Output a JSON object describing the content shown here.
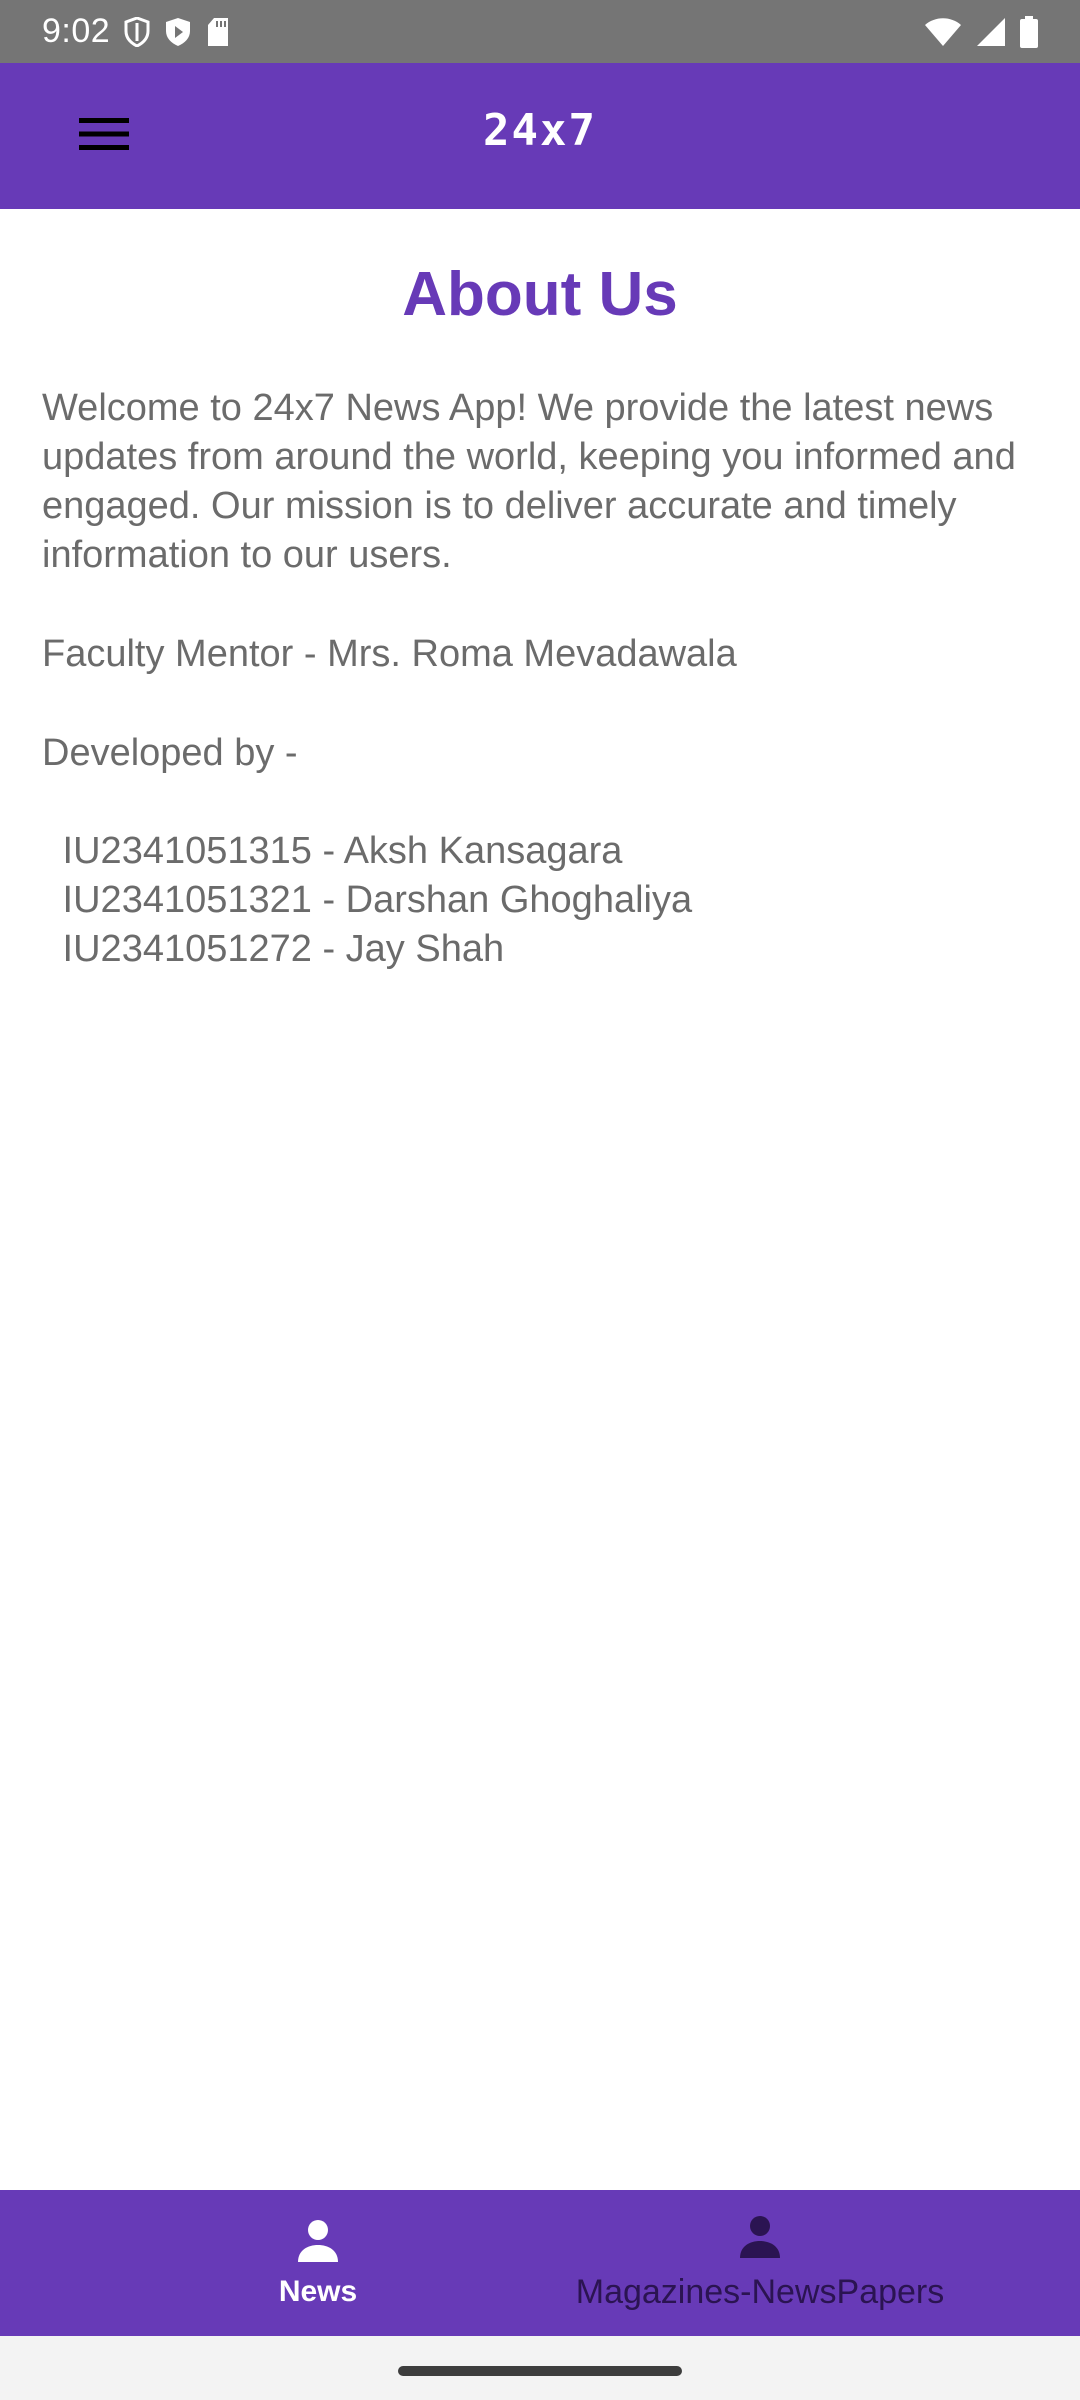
{
  "status_bar": {
    "time": "9:02",
    "icons": [
      "shield-icon",
      "play-protect-icon",
      "sd-card-icon",
      "wifi-icon",
      "signal-icon",
      "battery-icon"
    ]
  },
  "app_bar": {
    "title": "24x7",
    "menu_icon": "hamburger-menu-icon",
    "color": "#673AB7"
  },
  "about": {
    "heading": "About Us",
    "description": "Welcome to 24x7 News App! We provide the latest news updates from around the world, keeping you informed and engaged. Our mission is to deliver accurate and timely information to our users.",
    "mentor": "Faculty Mentor - Mrs. Roma Mevadawala",
    "developed_by_label": "Developed by -",
    "developers": [
      " IU2341051315 - Aksh Kansagara",
      " IU2341051321 - Darshan Ghoghaliya",
      " IU2341051272 - Jay Shah"
    ]
  },
  "bottom_nav": {
    "items": [
      {
        "label": "News",
        "icon": "person-icon",
        "active": true
      },
      {
        "label": "Magazines-NewsPapers",
        "icon": "person-icon",
        "active": false
      }
    ]
  }
}
